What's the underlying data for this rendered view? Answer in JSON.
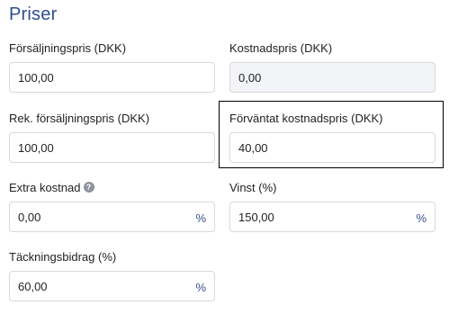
{
  "section": {
    "title": "Priser"
  },
  "fields": {
    "sales_price": {
      "label": "Försäljningspris (DKK)",
      "value": "100,00"
    },
    "cost_price": {
      "label": "Kostnadspris (DKK)",
      "value": "0,00"
    },
    "rec_sales_price": {
      "label": "Rek. försäljningspris (DKK)",
      "value": "100,00"
    },
    "expected_cost_price": {
      "label": "Förväntat kostnadspris (DKK)",
      "value": "40,00"
    },
    "extra_cost": {
      "label": "Extra kostnad",
      "value": "0,00",
      "suffix": "%",
      "help_icon": "question-mark-icon"
    },
    "profit": {
      "label": "Vinst (%)",
      "value": "150,00",
      "suffix": "%"
    },
    "contribution_margin": {
      "label": "Täckningsbidrag (%)",
      "value": "60,00",
      "suffix": "%"
    }
  }
}
